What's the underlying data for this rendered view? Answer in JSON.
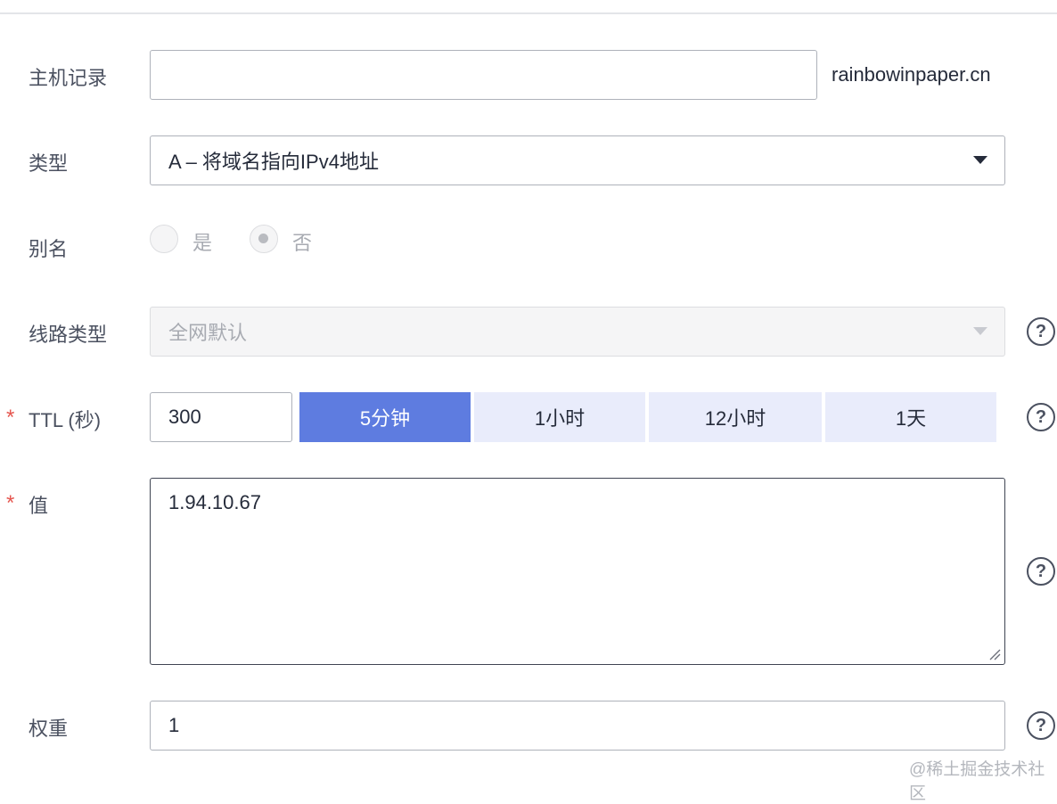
{
  "form": {
    "host_record": {
      "label": "主机记录",
      "value": "",
      "suffix": "rainbowinpaper.cn"
    },
    "type": {
      "label": "类型",
      "value": "A – 将域名指向IPv4地址",
      "icon": "chevron-down-icon"
    },
    "alias": {
      "label": "别名",
      "options": [
        "是",
        "否"
      ],
      "selected": "否"
    },
    "line_type": {
      "label": "线路类型",
      "value": "全网默认",
      "disabled": true
    },
    "ttl": {
      "required_mark": "*",
      "label": "TTL (秒)",
      "value": "300",
      "presets": [
        "5分钟",
        "1小时",
        "12小时",
        "1天"
      ],
      "selected_preset": "5分钟"
    },
    "value": {
      "required_mark": "*",
      "label": "值",
      "content": "1.94.10.67"
    },
    "weight": {
      "label": "权重",
      "value": "1"
    }
  },
  "help_icon": {
    "glyph": "?",
    "icon": "question-circle-icon"
  },
  "watermark": "@稀土掘金技术社区",
  "colors": {
    "primary": "#5e7ce0",
    "segment_bg": "#e9ecfb",
    "required": "#e5564f",
    "border": "#aeb2ba"
  }
}
